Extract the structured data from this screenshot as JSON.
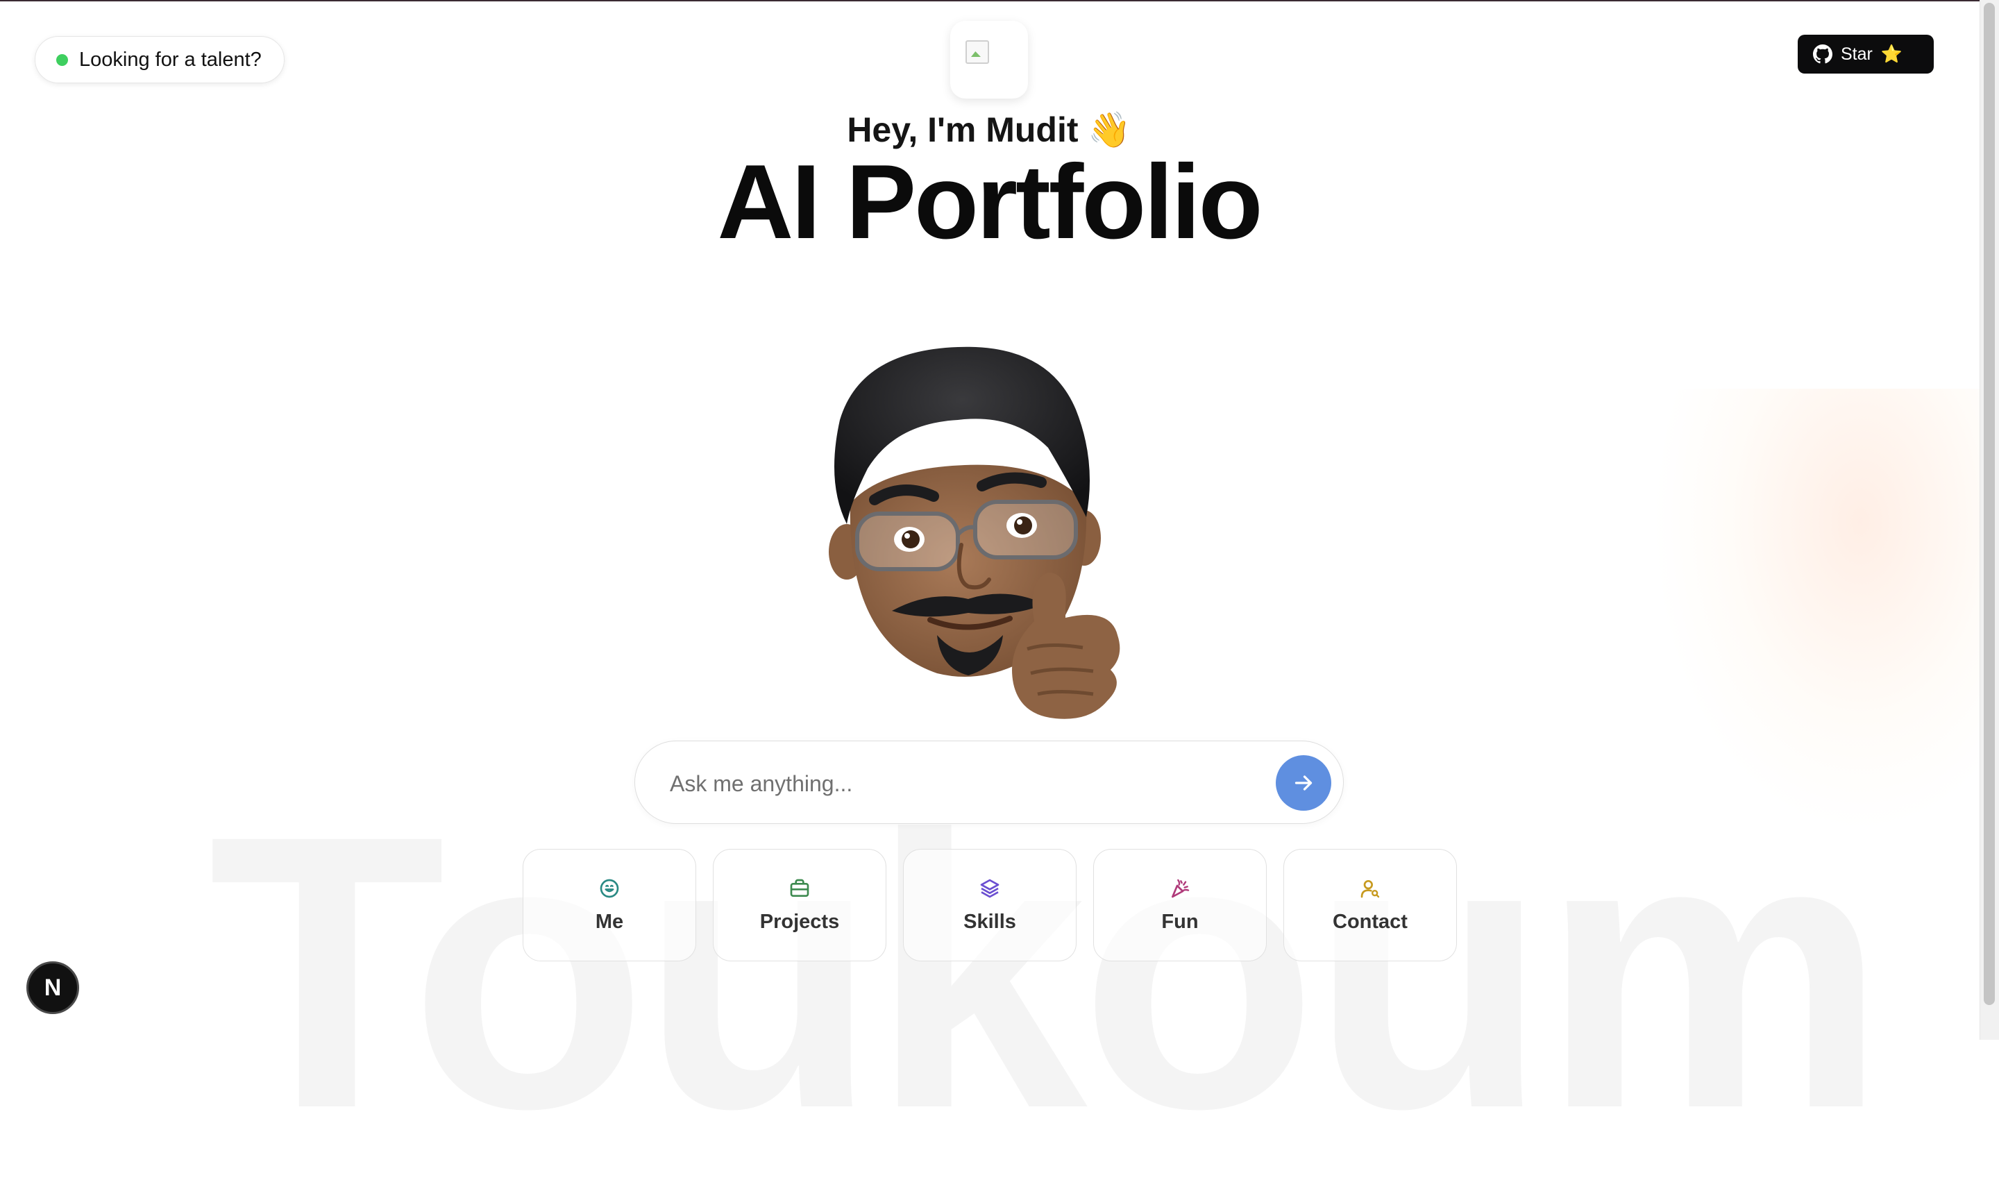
{
  "header": {
    "talent_label": "Looking for a talent?",
    "star_label": "Star",
    "star_emoji": "⭐"
  },
  "hero": {
    "greeting": "Hey, I'm Mudit 👋",
    "title": "AI Portfolio",
    "background_word": "Toukoum"
  },
  "chat": {
    "placeholder": "Ask me anything..."
  },
  "quick_actions": [
    {
      "label": "Me",
      "icon": "smile-icon",
      "color": "#2a8a84"
    },
    {
      "label": "Projects",
      "icon": "briefcase-icon",
      "color": "#3d8a4f"
    },
    {
      "label": "Skills",
      "icon": "layers-icon",
      "color": "#6b4fd1"
    },
    {
      "label": "Fun",
      "icon": "party-popper-icon",
      "color": "#b03a7a"
    },
    {
      "label": "Contact",
      "icon": "user-search-icon",
      "color": "#c79a1f"
    }
  ],
  "colors": {
    "send_button": "#5f8fe0",
    "status_dot": "#3ecf5f",
    "star_button": "#0c0c0d"
  },
  "badge": {
    "letter": "N"
  }
}
